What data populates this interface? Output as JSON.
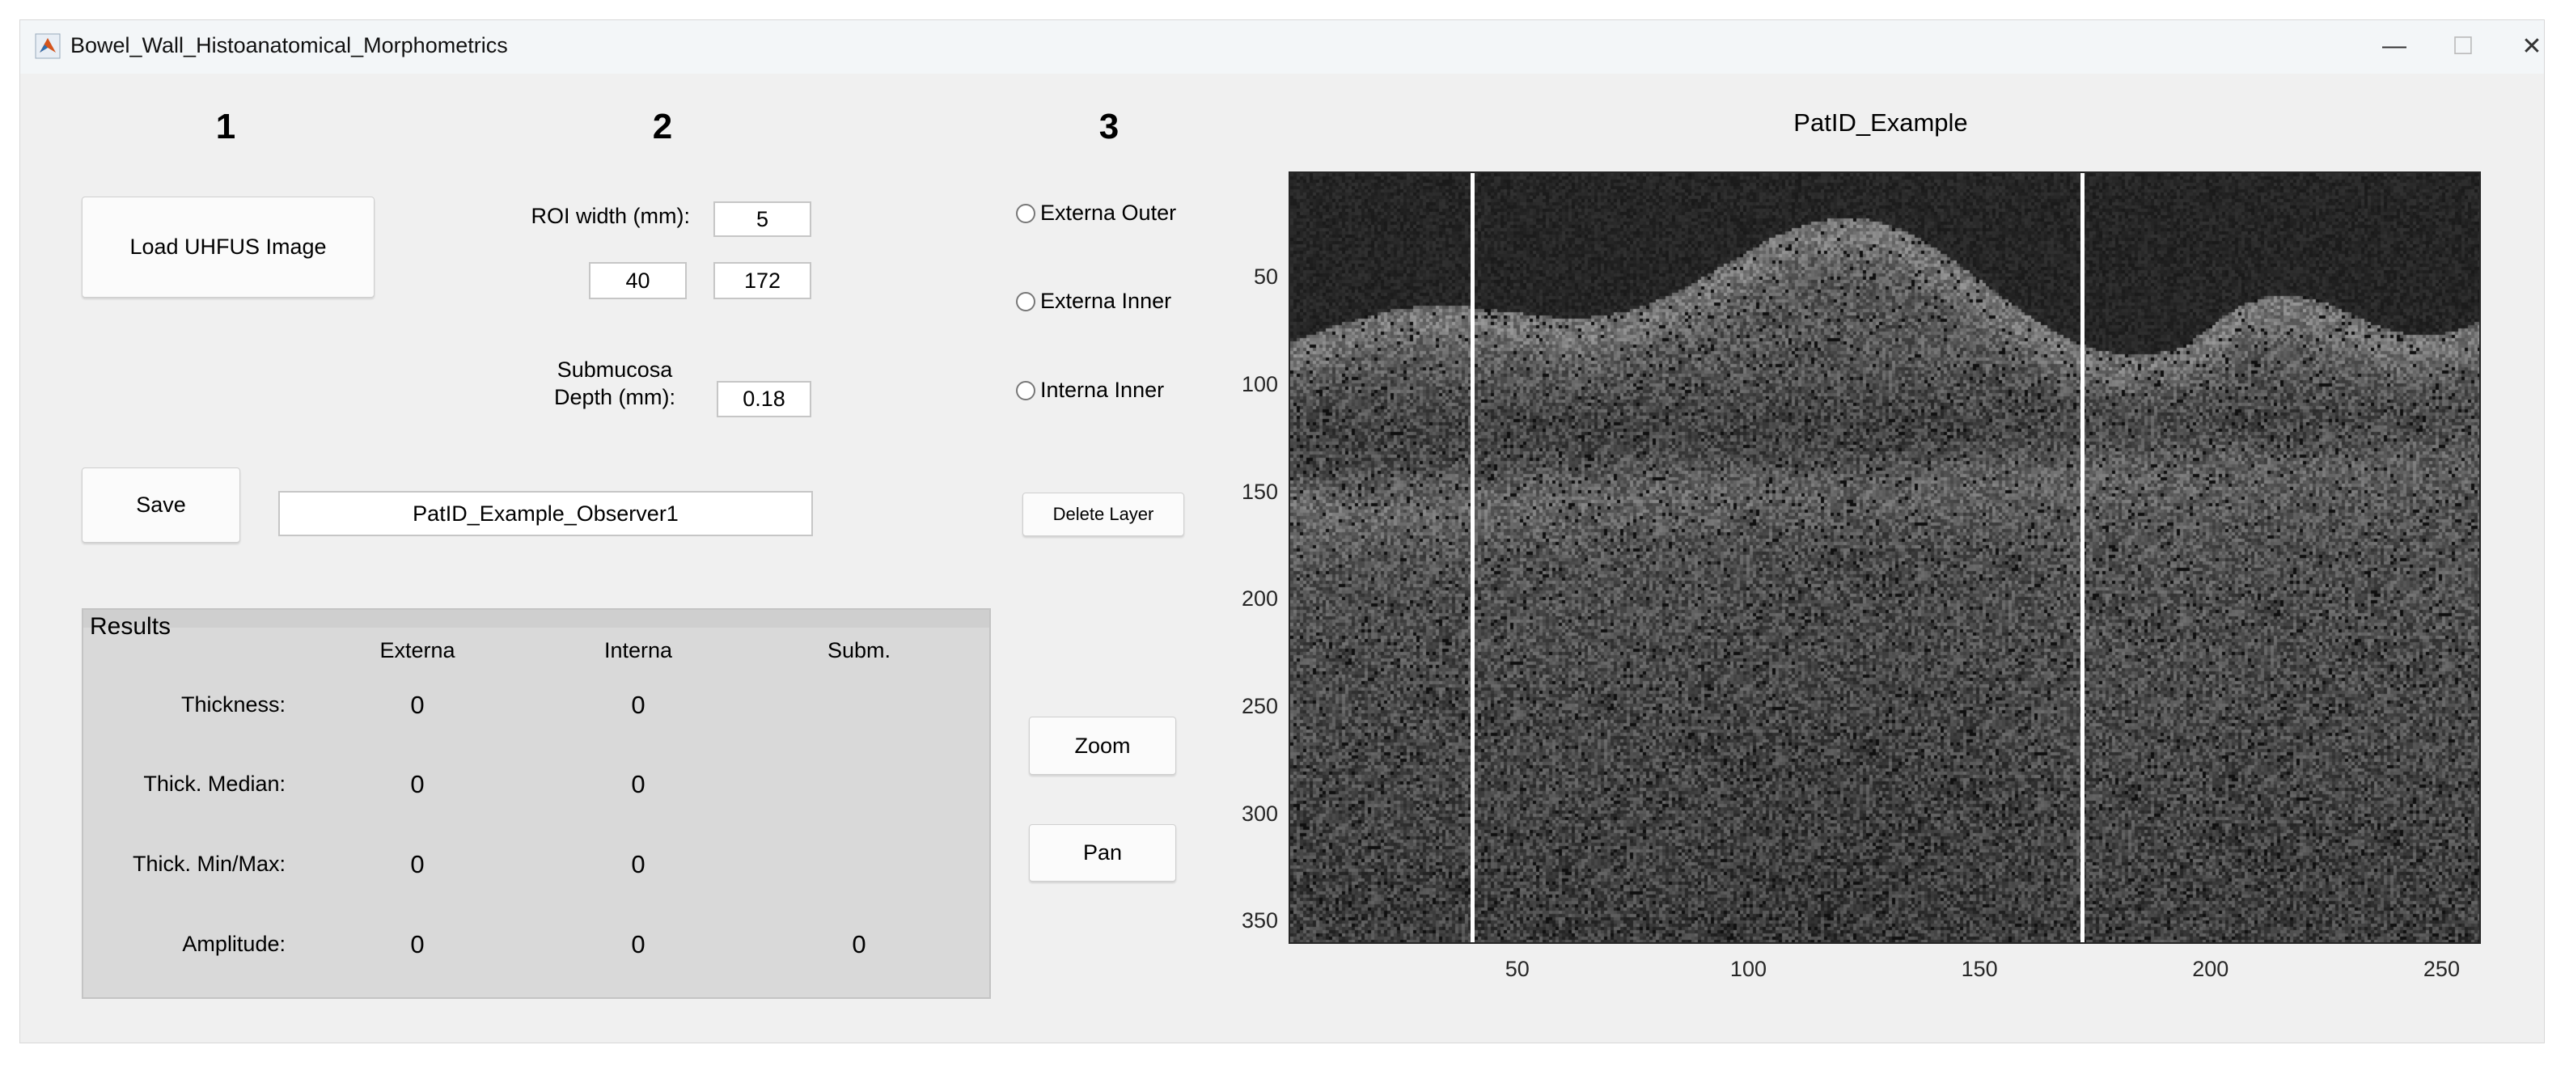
{
  "window": {
    "title": "Bowel_Wall_Histoanatomical_Morphometrics",
    "controls": {
      "minimize": "—",
      "maximize": "☐",
      "close": "✕"
    }
  },
  "steps": [
    "1",
    "2",
    "3"
  ],
  "step1": {
    "load_button": "Load UHFUS Image",
    "save_button": "Save",
    "filename": "PatID_Example_Observer1"
  },
  "step2": {
    "roi_width_label": "ROI width (mm):",
    "roi_width_value": "5",
    "roi_start": "40",
    "roi_end": "172",
    "submucosa_label_line1": "Submucosa",
    "submucosa_label_line2": "Depth (mm):",
    "submucosa_value": "0.18"
  },
  "step3": {
    "radios": [
      {
        "label": "Externa Outer",
        "selected": false
      },
      {
        "label": "Externa Inner",
        "selected": false
      },
      {
        "label": "Interna Inner",
        "selected": false
      }
    ],
    "delete_layer": "Delete Layer",
    "zoom_button": "Zoom",
    "pan_button": "Pan"
  },
  "results": {
    "title": "Results",
    "columns": [
      "Externa",
      "Interna",
      "Subm."
    ],
    "rows": [
      {
        "label": "Thickness:",
        "values": [
          "0",
          "0",
          ""
        ]
      },
      {
        "label": "Thick. Median:",
        "values": [
          "0",
          "0",
          ""
        ]
      },
      {
        "label": "Thick. Min/Max:",
        "values": [
          "0",
          "0",
          ""
        ]
      },
      {
        "label": "Amplitude:",
        "values": [
          "0",
          "0",
          "0"
        ]
      }
    ]
  },
  "plot": {
    "title": "PatID_Example",
    "xlim": [
      0.5,
      258.5
    ],
    "ylim": [
      0.5,
      360.5
    ],
    "xticks": [
      "50",
      "100",
      "150",
      "200",
      "250"
    ],
    "yticks": [
      "50",
      "100",
      "150",
      "200",
      "250",
      "300",
      "350"
    ],
    "roi_lines_x": [
      40,
      172
    ],
    "roi_line_color": "#ffffff"
  }
}
